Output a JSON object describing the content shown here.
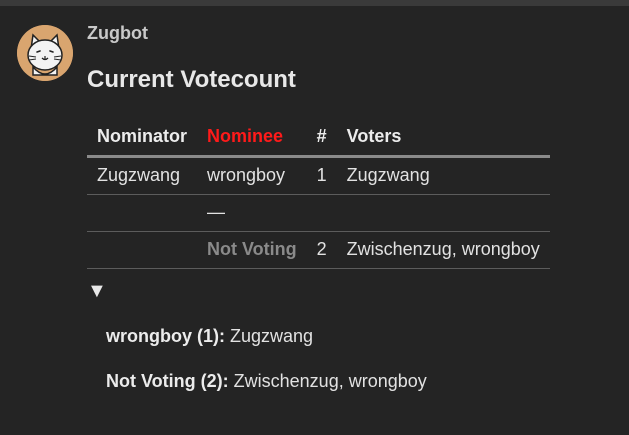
{
  "post": {
    "username": "Zugbot",
    "title": "Current Votecount"
  },
  "table": {
    "headers": {
      "nominator": "Nominator",
      "nominee": "Nominee",
      "count": "#",
      "voters": "Voters"
    },
    "rows": [
      {
        "nominator": "Zugzwang",
        "nominee": "wrongboy",
        "count": "1",
        "voters": "Zugzwang"
      },
      {
        "nominator": "",
        "nominee": "—",
        "count": "",
        "voters": ""
      },
      {
        "nominator": "",
        "nominee": "Not Voting",
        "count": "2",
        "voters": "Zwischenzug, wrongboy"
      }
    ]
  },
  "toggle": {
    "glyph": "▼",
    "icon": "triangle-down-icon"
  },
  "summary": [
    {
      "label": "wrongboy (1):",
      "voters": "Zugzwang"
    },
    {
      "label": "Not Voting (2):",
      "voters": "Zwischenzug, wrongboy"
    }
  ],
  "colors": {
    "background": "#242424",
    "nominee_header": "#ff1a1a",
    "not_voting": "#8a8a8a"
  }
}
